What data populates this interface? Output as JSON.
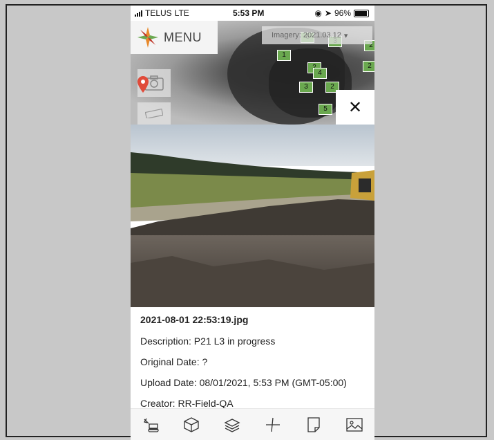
{
  "status_bar": {
    "carrier": "TELUS",
    "network": "LTE",
    "time": "5:53 PM",
    "battery": "96%"
  },
  "map": {
    "menu_label": "MENU",
    "imagery_label": "Imagery: 2021.03.12",
    "markers": [
      "1",
      "2",
      "3",
      "4",
      "5",
      "6",
      "2",
      "3",
      "2",
      "2"
    ]
  },
  "photo_detail": {
    "filename": "2021-08-01 22:53:19.jpg",
    "description": "Description: P21 L3 in progress",
    "original_date": "Original Date: ?",
    "upload_date": "Upload Date: 08/01/2021, 5:53 PM (GMT-05:00)",
    "creator": "Creator: RR-Field-QA"
  },
  "toolbar": {
    "icons": [
      "excavator-icon",
      "cube-icon",
      "layers-icon",
      "measure-icon",
      "note-icon",
      "image-icon"
    ]
  },
  "colors": {
    "accent_orange": "#e8892b",
    "accent_green": "#6aa84f",
    "marker_red": "#e04b3a"
  }
}
